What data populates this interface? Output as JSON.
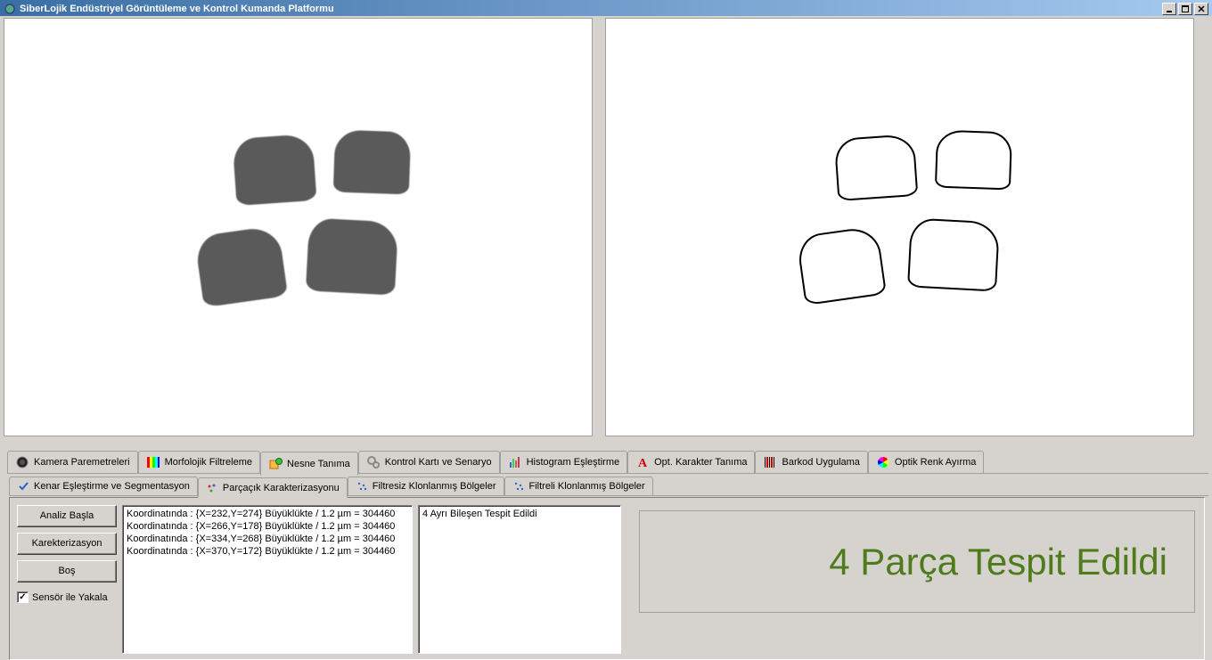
{
  "titlebar": {
    "title": "SiberLojik Endüstriyel Görüntüleme ve Kontrol Kumanda Platformu"
  },
  "main_tabs": [
    {
      "label": "Kamera Paremetreleri"
    },
    {
      "label": "Morfolojik Filtreleme"
    },
    {
      "label": "Nesne Tanıma"
    },
    {
      "label": "Kontrol Kartı ve Senaryo"
    },
    {
      "label": "Histogram Eşleştirme"
    },
    {
      "label": "Opt. Karakter Tanıma"
    },
    {
      "label": "Barkod Uygulama"
    },
    {
      "label": "Optik Renk Ayırma"
    }
  ],
  "sub_tabs": [
    {
      "label": "Kenar Eşleştirme ve Segmentasyon"
    },
    {
      "label": "Parçaçık Karakterizasyonu"
    },
    {
      "label": "Filtresiz Klonlanmış Bölgeler"
    },
    {
      "label": "Filtreli Klonlanmış Bölgeler"
    }
  ],
  "controls": {
    "analyze": "Analiz Başla",
    "characterize": "Karekterizasyon",
    "clear": "Boş",
    "sensor_checkbox": "Sensör ile Yakala"
  },
  "coords_list": [
    "Koordinatında :   {X=232,Y=274} Büyüklükte / 1.2 µm = 304460",
    "Koordinatında :   {X=266,Y=178} Büyüklükte / 1.2 µm = 304460",
    "Koordinatında :   {X=334,Y=268} Büyüklükte / 1.2 µm = 304460",
    "Koordinatında :   {X=370,Y=172} Büyüklükte / 1.2 µm = 304460"
  ],
  "message_list": [
    "4 Ayrı Bileşen Tespit Edildi"
  ],
  "result_text": "4 Parça Tespit Edildi"
}
